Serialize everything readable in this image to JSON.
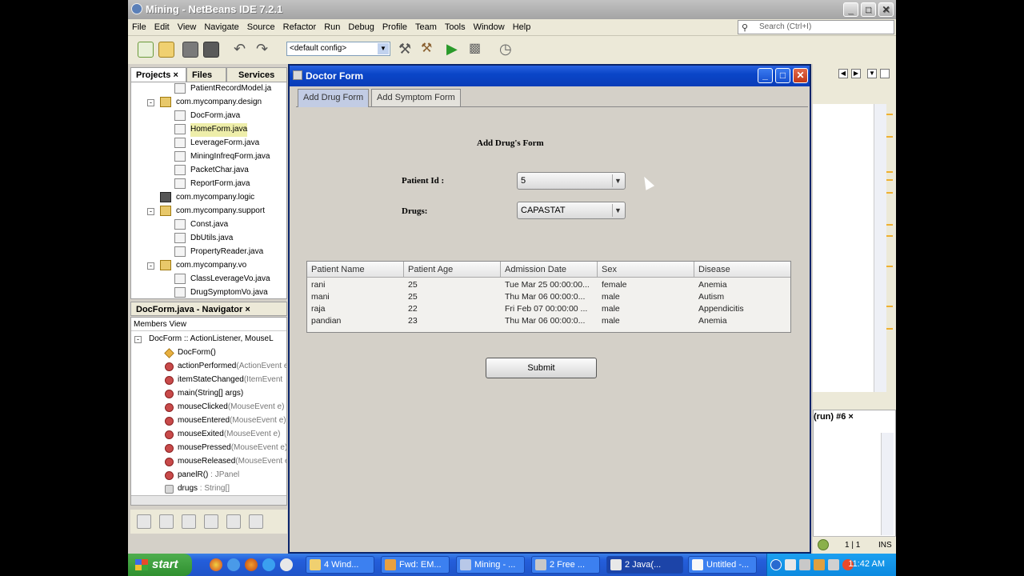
{
  "ide": {
    "title": "Mining - NetBeans IDE 7.2.1",
    "window_buttons": [
      "_",
      "□",
      "✕"
    ],
    "menu": [
      "File",
      "Edit",
      "View",
      "Navigate",
      "Source",
      "Refactor",
      "Run",
      "Debug",
      "Profile",
      "Team",
      "Tools",
      "Window",
      "Help"
    ],
    "search_placeholder": "Search (Ctrl+I)",
    "config": "<default config>"
  },
  "projects_panel": {
    "tabs": [
      "Projects",
      "Files",
      "Services"
    ],
    "tree": [
      {
        "label": "PatientRecordModel.ja",
        "type": "file",
        "level": 2
      },
      {
        "label": "com.mycompany.design",
        "type": "package",
        "level": 1
      },
      {
        "label": "DocForm.java",
        "type": "file",
        "level": 2
      },
      {
        "label": "HomeForm.java",
        "type": "file",
        "level": 2
      },
      {
        "label": "LeverageForm.java",
        "type": "file",
        "level": 2
      },
      {
        "label": "MiningInfreqForm.java",
        "type": "file",
        "level": 2
      },
      {
        "label": "PacketChar.java",
        "type": "file",
        "level": 2
      },
      {
        "label": "ReportForm.java",
        "type": "file",
        "level": 2
      },
      {
        "label": "com.mycompany.logic",
        "type": "package-empty",
        "level": 1
      },
      {
        "label": "com.mycompany.support",
        "type": "package",
        "level": 1
      },
      {
        "label": "Const.java",
        "type": "file",
        "level": 2
      },
      {
        "label": "DbUtils.java",
        "type": "file",
        "level": 2
      },
      {
        "label": "PropertyReader.java",
        "type": "file",
        "level": 2
      },
      {
        "label": "com.mycompany.vo",
        "type": "package",
        "level": 1
      },
      {
        "label": "ClassLeverageVo.java",
        "type": "file",
        "level": 2
      },
      {
        "label": "DrugSymptomVo.java",
        "type": "file",
        "level": 2
      }
    ]
  },
  "navigator": {
    "title": "DocForm.java - Navigator",
    "members_view": "Members View",
    "root": "DocForm :: ActionListener, MouseL",
    "members": [
      {
        "name": "DocForm()",
        "sig": ""
      },
      {
        "name": "actionPerformed",
        "sig": "(ActionEvent e"
      },
      {
        "name": "itemStateChanged",
        "sig": "(ItemEvent"
      },
      {
        "name": "main(String[] args)",
        "sig": ""
      },
      {
        "name": "mouseClicked",
        "sig": "(MouseEvent e)"
      },
      {
        "name": "mouseEntered",
        "sig": "(MouseEvent e)"
      },
      {
        "name": "mouseExited",
        "sig": "(MouseEvent e)"
      },
      {
        "name": "mousePressed",
        "sig": "(MouseEvent e)"
      },
      {
        "name": "mouseReleased",
        "sig": "(MouseEvent e"
      },
      {
        "name": "panelR()",
        "sig": " : JPanel"
      },
      {
        "name": "drugs",
        "sig": " : String[]"
      }
    ]
  },
  "output": {
    "tab": "(run) #6"
  },
  "status": {
    "position": "1 | 1",
    "mode": "INS"
  },
  "dialog": {
    "title": "Doctor Form",
    "tabs": [
      "Add Drug Form",
      "Add Symptom Form"
    ],
    "form_title": "Add Drug's Form",
    "patient_label": "Patient Id :",
    "patient_value": "5",
    "drugs_label": "Drugs:",
    "drugs_value": "CAPASTAT",
    "table": {
      "columns": [
        "Patient Name",
        "Patient Age",
        "Admission Date",
        "Sex",
        "Disease"
      ],
      "rows": [
        [
          "rani",
          "25",
          "Tue Mar 25 00:00:00...",
          "female",
          "Anemia"
        ],
        [
          "mani",
          "25",
          "Thu Mar 06 00:00:0...",
          "male",
          "Autism"
        ],
        [
          "raja",
          "22",
          "Fri Feb 07 00:00:00 ...",
          "male",
          "Appendicitis"
        ],
        [
          "pandian",
          "23",
          "Thu Mar 06 00:00:0...",
          "male",
          "Anemia"
        ]
      ]
    },
    "submit": "Submit"
  },
  "taskbar": {
    "start": "start",
    "tasks": [
      "4 Wind...",
      "Fwd: EM...",
      "Mining - ...",
      "2 Free ...",
      "2 Java(...",
      "Untitled -..."
    ],
    "clock": "11:42 AM"
  }
}
